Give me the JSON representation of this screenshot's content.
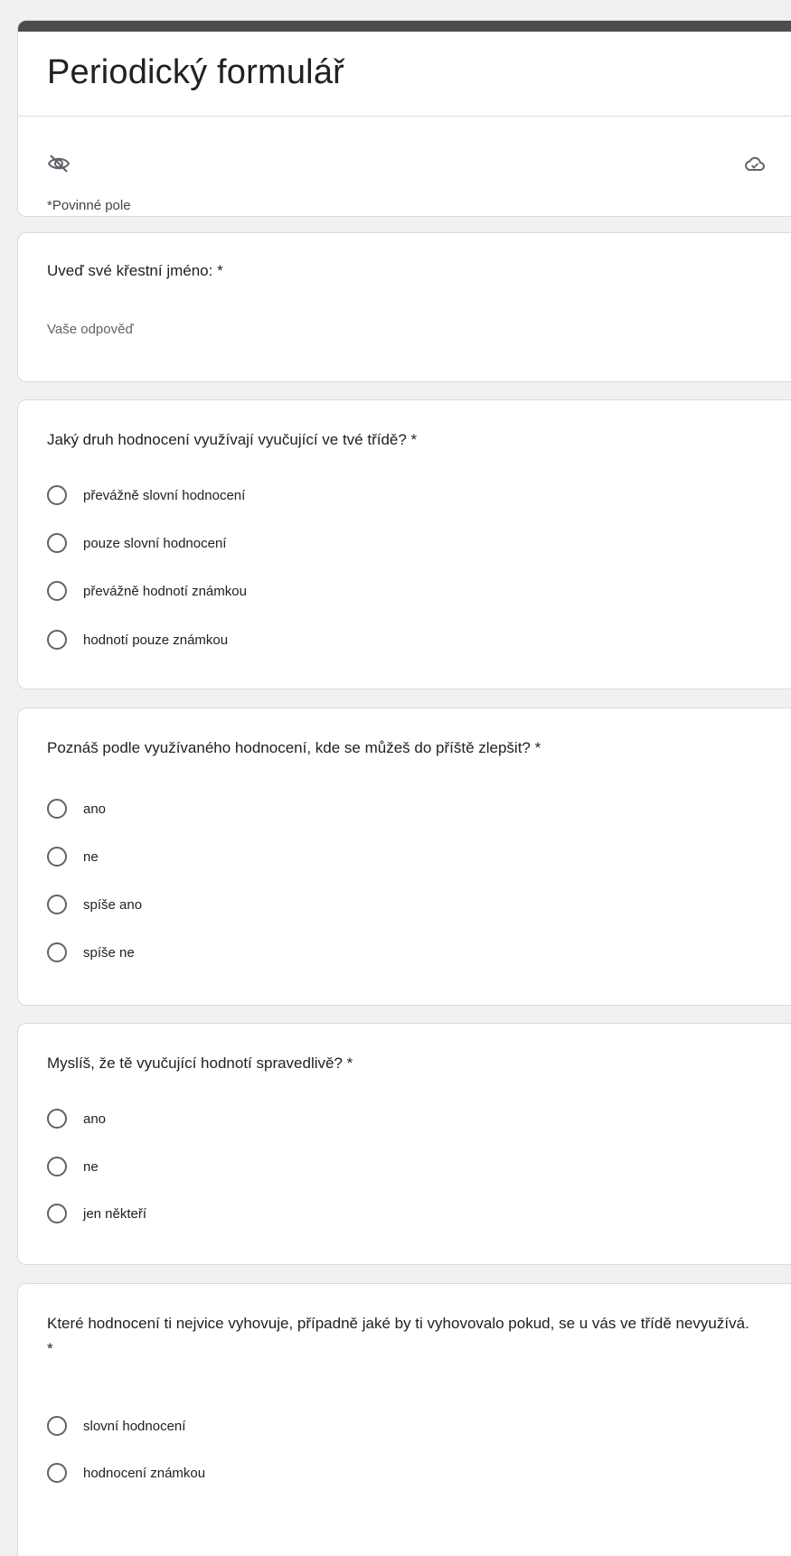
{
  "form": {
    "title": "Periodický formulář",
    "required_note": "*Povinné pole"
  },
  "questions": [
    {
      "label": "Uveď své křestní jméno: *",
      "placeholder": "Vaše odpověď"
    },
    {
      "label": "Jaký druh hodnocení využívají vyučující ve tvé třídě? *",
      "options": [
        "převážně slovní hodnocení",
        "pouze slovní hodnocení",
        "převážně hodnotí známkou",
        "hodnotí pouze známkou"
      ]
    },
    {
      "label": "Poznáš podle využívaného hodnocení, kde se můžeš do příště zlepšit? *",
      "options": [
        "ano",
        "ne",
        "spíše ano",
        "spíše ne"
      ]
    },
    {
      "label": "Myslíš, že tě vyučující hodnotí spravedlivě? *",
      "options": [
        "ano",
        "ne",
        "jen někteří"
      ]
    },
    {
      "label": "Které hodnocení ti nejvice vyhovuje, případně jaké by ti vyhovovalo pokud, se u vás ve třídě nevyužívá. *",
      "options": [
        "slovní hodnocení",
        "hodnocení známkou"
      ]
    }
  ],
  "icons": {
    "visibility": "eye-off-icon",
    "save_status": "cloud-icon"
  },
  "colors": {
    "header_bar": "#4d4d4d",
    "background": "#f1f1f1"
  }
}
